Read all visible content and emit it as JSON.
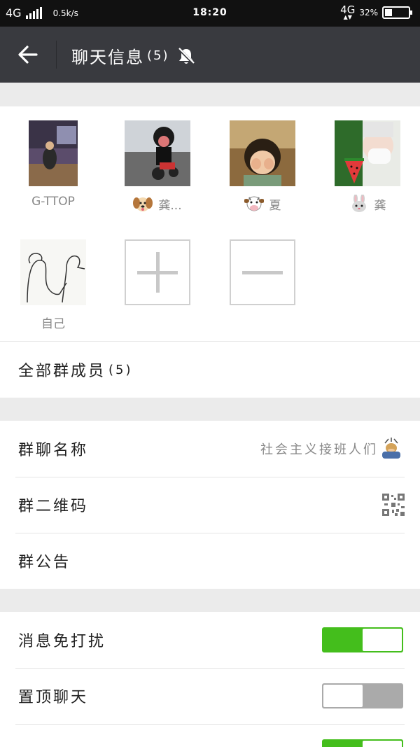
{
  "status_bar": {
    "network_left": "4G",
    "speed": "0.5k/s",
    "time": "18:20",
    "network_right": "4G",
    "battery_percent": "32%",
    "battery_level": 0.32
  },
  "header": {
    "title": "聊天信息",
    "count": "(5)",
    "icons": {
      "back": "back-arrow-icon",
      "mute": "bell-off-icon"
    }
  },
  "members": [
    {
      "name": "G-TTOP",
      "emoji": ""
    },
    {
      "name": "龚...",
      "emoji": "dog-face"
    },
    {
      "name": "夏",
      "emoji": "cow-face"
    },
    {
      "name": "龚",
      "emoji": "rabbit-face"
    },
    {
      "name": "自己",
      "emoji": ""
    }
  ],
  "member_actions": {
    "add": "plus-icon",
    "remove": "minus-icon"
  },
  "all_members": {
    "label": "全部群成员",
    "count": "(5)"
  },
  "group_info": {
    "name_label": "群聊名称",
    "name_value": "社会主义接班人们",
    "qrcode_label": "群二维码",
    "notice_label": "群公告"
  },
  "settings": {
    "mute_label": "消息免打扰",
    "mute_on": true,
    "pin_label": "置顶聊天",
    "pin_on": false,
    "third_on": true
  },
  "colors": {
    "header_bg": "#393a3f",
    "toggle_on": "#44be1c",
    "toggle_off": "#aaaaaa",
    "page_bg": "#ebebeb"
  }
}
